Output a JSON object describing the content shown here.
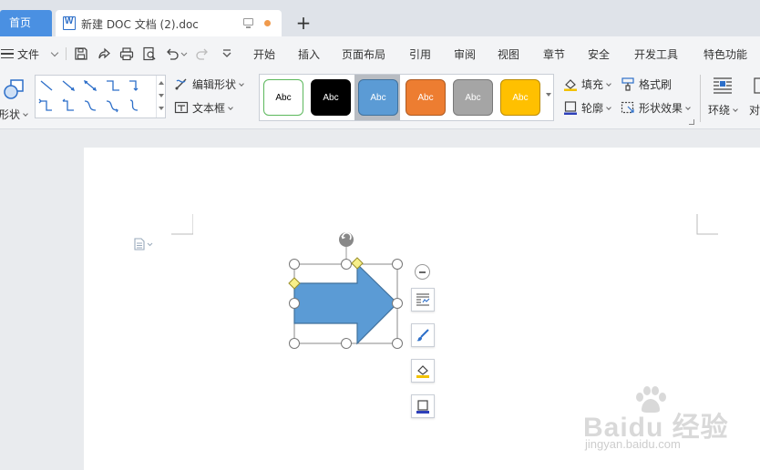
{
  "tabs": {
    "home_label": "首页",
    "doc_title": "新建 DOC 文档 (2).doc",
    "add_label": "+"
  },
  "menu": {
    "file_label": "文件",
    "items": [
      "开始",
      "插入",
      "页面布局",
      "引用",
      "审阅",
      "视图",
      "章节",
      "安全",
      "开发工具",
      "特色功能"
    ]
  },
  "ribbon": {
    "shape_label": "形状",
    "edit_shape_label": "编辑形状",
    "textbox_label": "文本框",
    "styles": [
      {
        "label": "Abc",
        "fill": "#ffffff",
        "border": "#5cb85c",
        "text": "#000000"
      },
      {
        "label": "Abc",
        "fill": "#000000",
        "border": "#000000",
        "text": "#ffffff"
      },
      {
        "label": "Abc",
        "fill": "#5b9bd5",
        "border": "#41719c",
        "text": "#ffffff",
        "selected": true
      },
      {
        "label": "Abc",
        "fill": "#ed7d31",
        "border": "#ae5a21",
        "text": "#ffffff"
      },
      {
        "label": "Abc",
        "fill": "#a5a5a5",
        "border": "#787878",
        "text": "#ffffff"
      },
      {
        "label": "Abc",
        "fill": "#ffc000",
        "border": "#bc8c00",
        "text": "#ffffff"
      }
    ],
    "fill_label": "填充",
    "format_painter_label": "格式刷",
    "outline_label": "轮廓",
    "shape_effect_label": "形状效果",
    "wrap_label": "环绕",
    "align_label": "对"
  },
  "document": {
    "shape": {
      "name": "right-arrow",
      "fill": "#5b9bd5",
      "stroke": "#41719c"
    }
  },
  "watermark": {
    "brand": "Baidu 经验",
    "url": "jingyan.baidu.com"
  },
  "colors": {
    "accent": "#4a90e2",
    "tab_dot": "#f09a4c"
  }
}
